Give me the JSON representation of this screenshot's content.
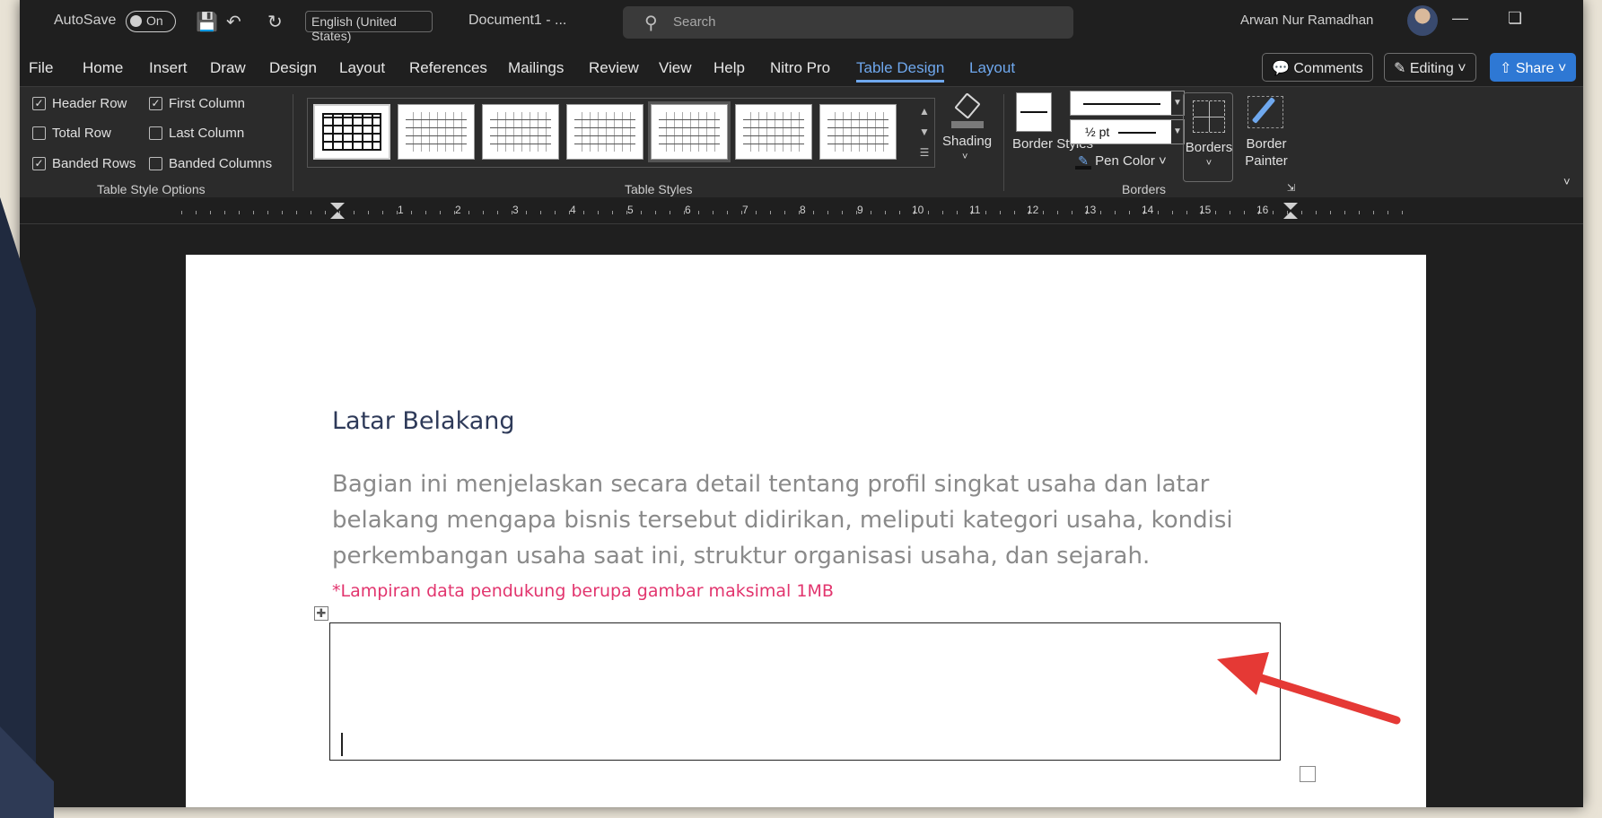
{
  "titlebar": {
    "autosave_label": "AutoSave",
    "autosave_state": "On",
    "language": "English (United States)",
    "document_name": "Document1 - ...",
    "search_placeholder": "Search",
    "user_name": "Arwan Nur Ramadhan"
  },
  "menu": {
    "tabs": [
      "File",
      "Home",
      "Insert",
      "Draw",
      "Design",
      "Layout",
      "References",
      "Mailings",
      "Review",
      "View",
      "Help",
      "Nitro Pro",
      "Table Design",
      "Layout"
    ],
    "active_tab": "Table Design",
    "comments_label": "Comments",
    "editing_label": "Editing",
    "share_label": "Share"
  },
  "ribbon": {
    "table_style_options": {
      "label": "Table Style Options",
      "options": [
        {
          "label": "Header Row",
          "checked": true
        },
        {
          "label": "First Column",
          "checked": true
        },
        {
          "label": "Total Row",
          "checked": false
        },
        {
          "label": "Last Column",
          "checked": false
        },
        {
          "label": "Banded Rows",
          "checked": true
        },
        {
          "label": "Banded Columns",
          "checked": false
        }
      ]
    },
    "table_styles": {
      "label": "Table Styles",
      "swatch_count": 7
    },
    "shading_label": "Shading",
    "borders": {
      "label": "Borders",
      "border_styles_label": "Border Styles",
      "line_weight": "½ pt",
      "pen_color_label": "Pen Color",
      "borders_label": "Borders",
      "border_painter_label": "Border Painter",
      "pen_color": "#111111"
    }
  },
  "ruler": {
    "numbers": [
      "1",
      "2",
      "3",
      "4",
      "5",
      "6",
      "7",
      "8",
      "9",
      "10",
      "11",
      "12",
      "13",
      "14",
      "15",
      "16"
    ]
  },
  "document": {
    "heading": "Latar Belakang",
    "body": "Bagian ini menjelaskan secara detail tentang profil singkat usaha dan latar belakang mengapa bisnis tersebut didirikan, meliputi kategori usaha, kondisi perkembangan usaha saat ini, struktur organisasi usaha, dan sejarah.",
    "note": "*Lampiran data pendukung berupa gambar maksimal 1MB"
  },
  "colors": {
    "accent": "#6fa8ee",
    "share": "#2e78d4",
    "note": "#e2356e",
    "arrow": "#e53935"
  }
}
